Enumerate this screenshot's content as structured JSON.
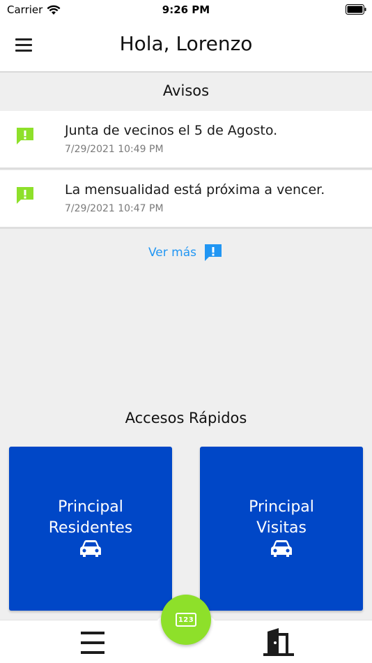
{
  "status_bar": {
    "carrier": "Carrier",
    "time": "9:26 PM"
  },
  "header": {
    "title": "Hola, Lorenzo",
    "menu_icon": "hamburger-icon"
  },
  "avisos": {
    "title": "Avisos",
    "items": [
      {
        "text": "Junta de vecinos el 5 de Agosto.",
        "date": "7/29/2021 10:49 PM",
        "icon": "alert-message-icon"
      },
      {
        "text": "La mensualidad está próxima a vencer.",
        "date": "7/29/2021 10:47 PM",
        "icon": "alert-message-icon"
      }
    ],
    "ver_mas": "Ver más"
  },
  "accesos": {
    "title": "Accesos Rápidos",
    "tiles": [
      {
        "label": "Principal\nResidentes",
        "icon": "car-icon"
      },
      {
        "label": "Principal\nVisitas",
        "icon": "car-icon"
      }
    ]
  },
  "bottom_nav": {
    "fab_label": "123",
    "menu_icon": "hamburger-icon",
    "logout_icon": "door-exit-icon"
  },
  "colors": {
    "accent_green": "#8ee02a",
    "tile_blue": "#0047c7",
    "link_blue": "#2196f3",
    "background": "#efefef"
  }
}
